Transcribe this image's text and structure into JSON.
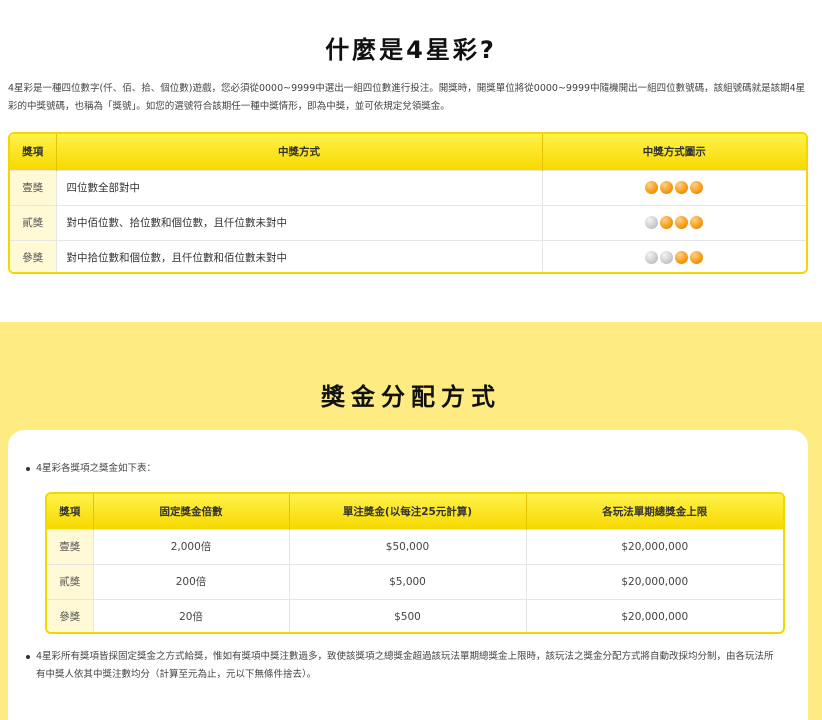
{
  "intro_section": {
    "title": "什麼是4星彩?",
    "description": "4星彩是一種四位數字(仟、佰、拾、個位數)遊戲，您必須從0000~9999中選出一組四位數進行投注。開獎時，開獎單位將從0000~9999中隨機開出一組四位數號碼，該組號碼就是該期4星彩的中獎號碼，也稱為「獎號」。如您的選號符合該期任一種中獎情形，即為中獎，並可依規定兌領獎金。",
    "table": {
      "headers": [
        "獎項",
        "中獎方式",
        "中獎方式圖示"
      ],
      "rows": [
        {
          "rank": "壹獎",
          "method": "四位數全部對中",
          "balls": [
            1,
            1,
            1,
            1
          ]
        },
        {
          "rank": "貳獎",
          "method": "對中佰位數、拾位數和個位數，且仟位數未對中",
          "balls": [
            0,
            1,
            1,
            1
          ]
        },
        {
          "rank": "參獎",
          "method": "對中拾位數和個位數，且仟位數和佰位數未對中",
          "balls": [
            0,
            0,
            1,
            1
          ]
        }
      ]
    }
  },
  "prize_section": {
    "title": "獎金分配方式",
    "bullet1": "4星彩各獎項之獎金如下表：",
    "table": {
      "headers": [
        "獎項",
        "固定獎金倍數",
        "單注獎金(以每注25元計算)",
        "各玩法單期總獎金上限"
      ],
      "rows": [
        {
          "rank": "壹獎",
          "multiplier": "2,000倍",
          "single": "$50,000",
          "cap": "$20,000,000"
        },
        {
          "rank": "貳獎",
          "multiplier": "200倍",
          "single": "$5,000",
          "cap": "$20,000,000"
        },
        {
          "rank": "參獎",
          "multiplier": "20倍",
          "single": "$500",
          "cap": "$20,000,000"
        }
      ]
    },
    "bullet2": "4星彩所有獎項皆採固定獎金之方式給獎，惟如有獎項中獎注數過多，致使該獎項之總獎金超過該玩法單期總獎金上限時，該玩法之獎金分配方式將自動改採均分制，由各玩法所有中獎人依其中獎注數均分（計算至元為止，元以下無條件捨去）。"
  },
  "colors": {
    "accent_yellow": "#f7d900",
    "section_background": "#feeb82",
    "ball_orange": "#f49a12",
    "ball_gray": "#c8c8c8"
  },
  "icons": {
    "win_ball": "orange-ball-icon",
    "miss_ball": "gray-ball-icon"
  }
}
